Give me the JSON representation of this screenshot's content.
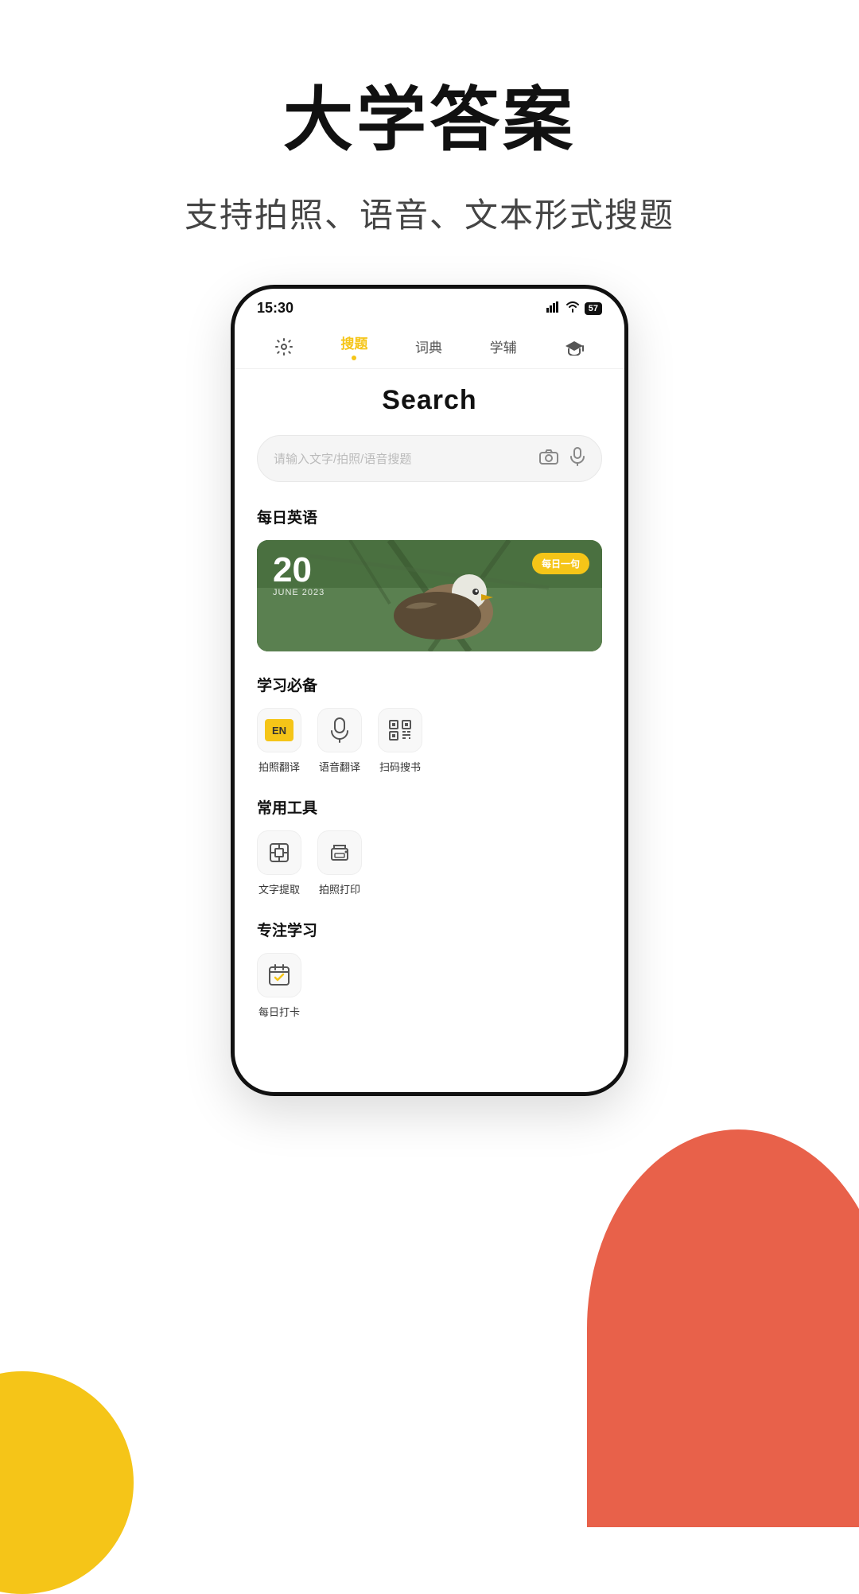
{
  "app": {
    "title": "大学答案",
    "subtitle": "支持拍照、语音、文本形式搜题"
  },
  "phone": {
    "status_bar": {
      "time": "15:30",
      "signal": "📶",
      "wifi": "WiFi",
      "battery": "57"
    },
    "nav_tabs": [
      {
        "id": "settings",
        "icon": "⚙",
        "label": "",
        "active": false
      },
      {
        "id": "search",
        "icon": "",
        "label": "搜题",
        "active": true
      },
      {
        "id": "dict",
        "icon": "",
        "label": "词典",
        "active": false
      },
      {
        "id": "tutor",
        "icon": "",
        "label": "学辅",
        "active": false
      },
      {
        "id": "cap",
        "icon": "🎓",
        "label": "",
        "active": false
      }
    ],
    "search_page": {
      "title": "Search",
      "search_placeholder": "请输入文字/拍照/语音搜题",
      "daily_english": {
        "section_title": "每日英语",
        "date_num": "20",
        "date_sub": "JUNE  2023",
        "badge": "每日一句"
      },
      "study_essentials": {
        "section_title": "学习必备",
        "items": [
          {
            "label": "拍照翻译",
            "icon_type": "translate"
          },
          {
            "label": "语音翻译",
            "icon_type": "mic"
          },
          {
            "label": "扫码搜书",
            "icon_type": "scan"
          }
        ]
      },
      "common_tools": {
        "section_title": "常用工具",
        "items": [
          {
            "label": "文字提取",
            "icon_type": "extract"
          },
          {
            "label": "拍照打印",
            "icon_type": "print"
          }
        ]
      },
      "focus_study": {
        "section_title": "专注学习",
        "items": [
          {
            "label": "每日打卡",
            "icon_type": "checkin"
          }
        ]
      }
    }
  },
  "colors": {
    "accent": "#F5C518",
    "bg_yellow": "#F5C518",
    "bg_red": "#E8614A"
  }
}
